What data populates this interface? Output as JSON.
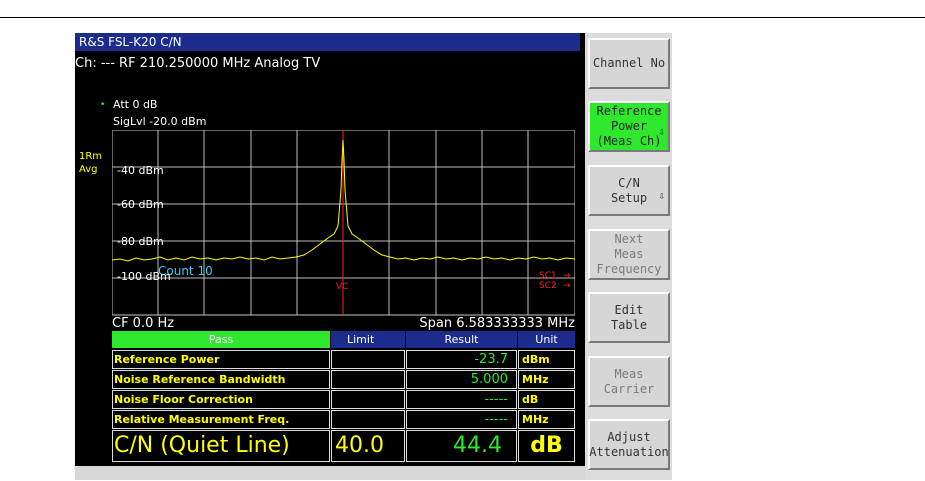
{
  "title": "R&S FSL-K20 C/N",
  "channel_info": "Ch: ---  RF 210.250000 MHz  Analog TV",
  "att_label": "Att  0 dB",
  "siglvl_label": "SigLvl -20.0 dBm",
  "trace_label_1": "1Rm",
  "trace_label_2": "Avg",
  "y_ticks": [
    "-40 dBm",
    "-60 dBm",
    "-80 dBm",
    "-100 dBm"
  ],
  "count_label": "Count 10",
  "vc_label": "VC",
  "sc1_label": "SC1",
  "sc2_label": "SC2",
  "cf_label": "CF 0.0 Hz",
  "span_label": "Span 6.583333333 MHz",
  "table": {
    "status": "Pass",
    "limit_header": "Limit",
    "lt_symbol": "<",
    "result_header": "Result",
    "unit_header": "Unit",
    "rows": [
      {
        "name": "Reference Power",
        "limit": "",
        "result": "-23.7",
        "unit": "dBm"
      },
      {
        "name": "Noise Reference Bandwidth",
        "limit": "",
        "result": "5.000",
        "unit": "MHz"
      },
      {
        "name": "Noise Floor Correction",
        "limit": "",
        "result": "-----",
        "unit": "dB"
      },
      {
        "name": "Relative Measurement Freq.",
        "limit": "",
        "result": "-----",
        "unit": "MHz"
      }
    ],
    "main": {
      "name": "C/N (Quiet Line)",
      "limit": "40.0",
      "result": "44.4",
      "unit": "dB"
    }
  },
  "softkeys": [
    {
      "label": "Channel No",
      "state": "normal"
    },
    {
      "label": "Reference\nPower\n(Meas Ch)",
      "state": "active",
      "icon": "down-arrow-icon"
    },
    {
      "label": "C/N\nSetup",
      "state": "normal",
      "icon": "down-arrow-icon"
    },
    {
      "label": "Next\nMeas\nFrequency",
      "state": "disabled"
    },
    {
      "label": "Edit\nTable",
      "state": "normal"
    },
    {
      "label": "Meas\nCarrier",
      "state": "disabled"
    },
    {
      "label": "Adjust\nAttenuation",
      "state": "normal"
    }
  ],
  "colors": {
    "accent_green": "#2ee82e",
    "title_blue": "#1c2c8c",
    "trace_yellow": "#ffff00",
    "marker_red": "#ff2020",
    "label_cyan": "#33ccff"
  }
}
